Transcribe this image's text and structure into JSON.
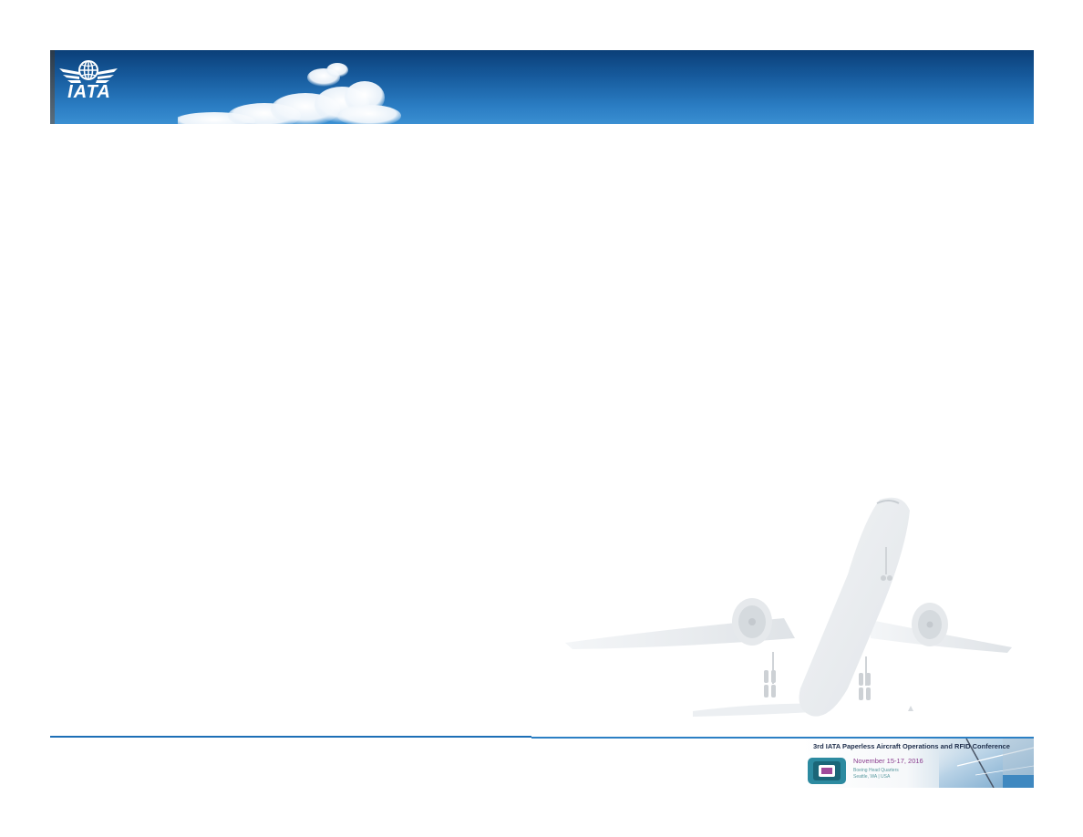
{
  "header": {
    "logo_text": "IATA",
    "logo_icon": "iata-globe-wings-logo",
    "background_color": "#165a9c"
  },
  "watermark": {
    "icon": "airplane-takeoff-watermark"
  },
  "footer": {
    "line_color": "#1d6fb6",
    "conference": {
      "title": "3rd IATA Paperless Aircraft Operations and RFID Conference",
      "date": "November 15-17, 2016",
      "venue": "Boeing Head Quarters",
      "location": "Seattle, WA | USA"
    }
  }
}
